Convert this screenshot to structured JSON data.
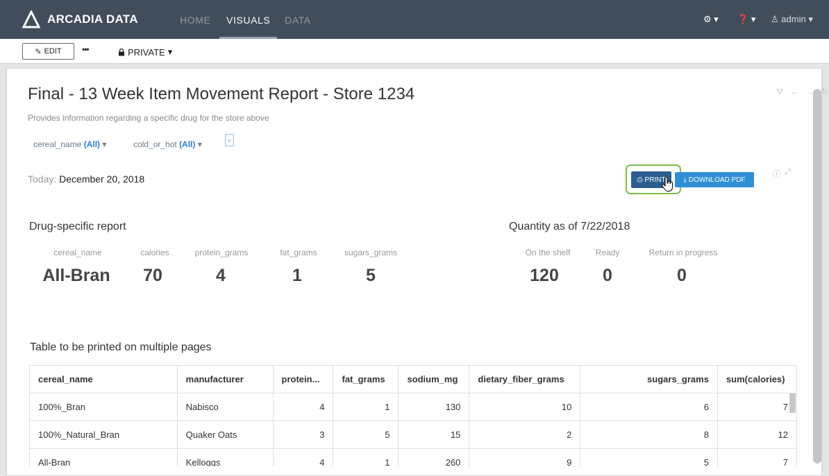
{
  "nav": {
    "brand": "ARCADIA DATA",
    "links": [
      "HOME",
      "VISUALS",
      "DATA"
    ],
    "active": "VISUALS",
    "user": "admin",
    "colors": {
      "bg": "#414d5a",
      "active": "#ffffff",
      "inactive": "#8e99a4"
    }
  },
  "toolbar": {
    "edit_label": "EDIT",
    "more_label": "•••",
    "privacy_label": "PRIVATE"
  },
  "report": {
    "title": "Final - 13 Week Item Movement Report - Store 1234",
    "subtitle": "Provides information regarding a specific drug for the store above",
    "filters": [
      {
        "name": "cereal_name",
        "value": "(All)"
      },
      {
        "name": "cold_or_hot",
        "value": "(All)"
      }
    ],
    "today_label": "Today:",
    "today_value": "December 20, 2018",
    "print_label": "PRINT",
    "download_label": "DOWNLOAD PDF",
    "accent_color": "#2f8fd5",
    "highlight_color": "#79c04a"
  },
  "drug_section": {
    "title": "Drug-specific report",
    "kpis": [
      {
        "label": "cereal_name",
        "value": "All-Bran"
      },
      {
        "label": "calories",
        "value": "70"
      },
      {
        "label": "protein_grams",
        "value": "4"
      },
      {
        "label": "fat_grams",
        "value": "1"
      },
      {
        "label": "sugars_grams",
        "value": "5"
      }
    ]
  },
  "quantity_section": {
    "title": "Quantity as of 7/22/2018",
    "kpis": [
      {
        "label": "On the shelf",
        "value": "120"
      },
      {
        "label": "Ready",
        "value": "0"
      },
      {
        "label": "Return in progress",
        "value": "0"
      }
    ]
  },
  "table": {
    "title": "Table to be printed on multiple pages",
    "headers": [
      "cereal_name",
      "manufacturer",
      "protein...",
      "fat_grams",
      "sodium_mg",
      "dietary_fiber_grams",
      "sugars_grams",
      "sum(calories)"
    ],
    "rows": [
      [
        "100%_Bran",
        "Nabisco",
        "4",
        "1",
        "130",
        "10",
        "6",
        "7"
      ],
      [
        "100%_Natural_Bran",
        "Quaker Oats",
        "3",
        "5",
        "15",
        "2",
        "8",
        "12"
      ],
      [
        "All-Bran",
        "Kelloggs",
        "4",
        "1",
        "260",
        "9",
        "5",
        "7"
      ]
    ]
  }
}
